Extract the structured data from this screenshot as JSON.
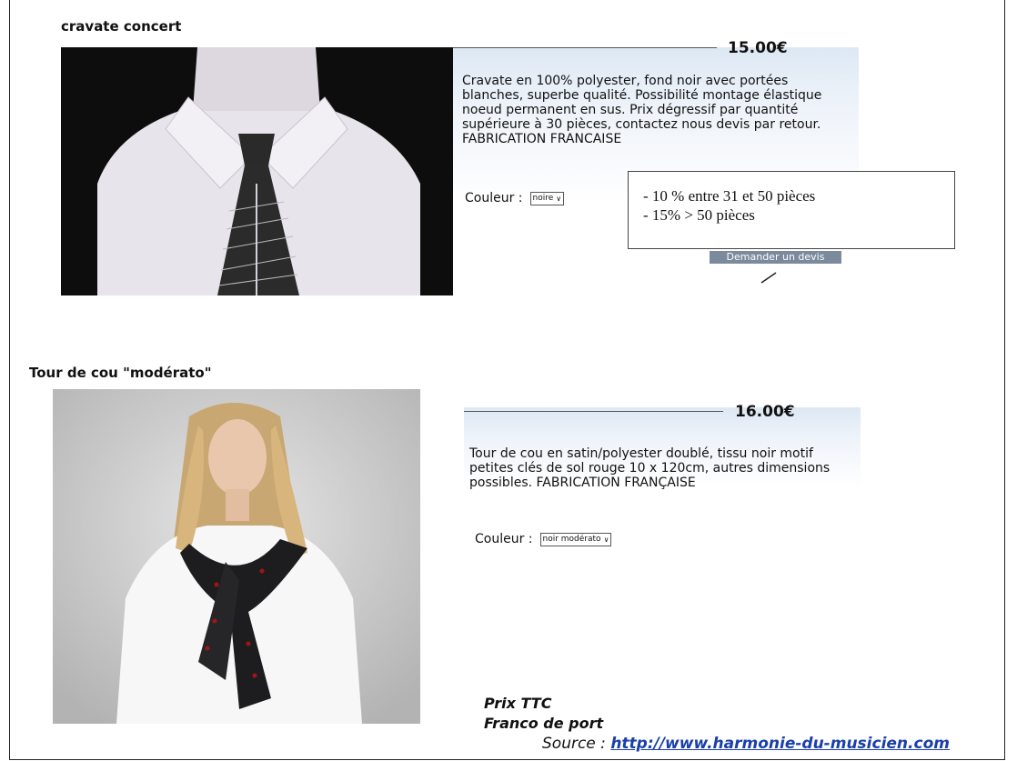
{
  "product1": {
    "title": "cravate concert",
    "price": "15.00€",
    "description": "Cravate en 100% polyester, fond noir avec portées blanches, superbe qualité. Possibilité montage élastique noeud permanent en sus. Prix dégressif par quantité supérieure à 30 pièces, contactez nous devis par retour. FABRICATION FRANCAISE",
    "color_label": "Couleur :",
    "color_value": "noire",
    "quote_button": "Demander un devis"
  },
  "discount_note": {
    "line1": "- 10 % entre 31 et 50 pièces",
    "line2": "- 15% > 50 pièces"
  },
  "product2": {
    "title": "Tour de cou \"modérato\"",
    "price": "16.00€",
    "description": "Tour de cou en satin/polyester doublé, tissu noir motif petites clés de sol rouge 10 x 120cm, autres dimensions possibles. FABRICATION FRANÇAISE",
    "color_label": "Couleur :",
    "color_value": "noir modérato"
  },
  "footer": {
    "prix": "Prix TTC",
    "franco": "Franco de port",
    "source_label": "Source :",
    "source_url": "http://www.harmonie-du-musicien.com"
  }
}
